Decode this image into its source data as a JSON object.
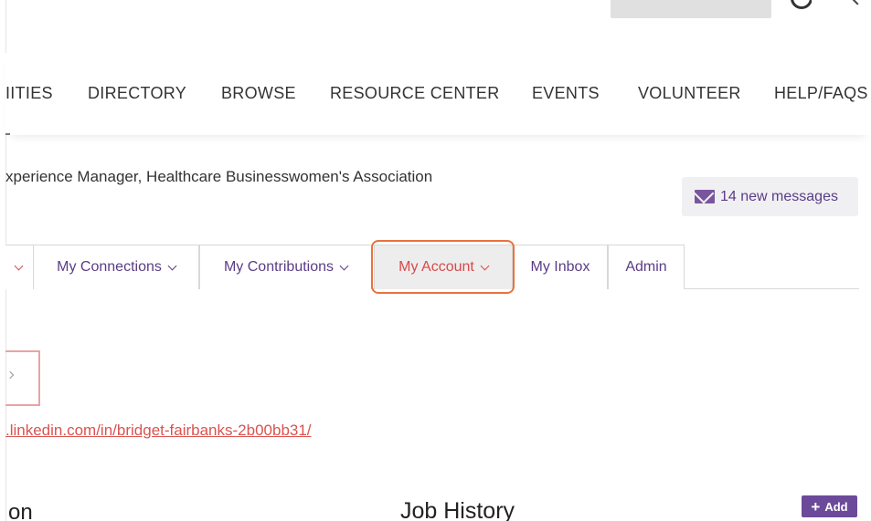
{
  "nav": {
    "items": [
      {
        "label": "IITIES"
      },
      {
        "label": "DIRECTORY"
      },
      {
        "label": "BROWSE"
      },
      {
        "label": "RESOURCE CENTER"
      },
      {
        "label": "EVENTS"
      },
      {
        "label": "VOLUNTEER"
      },
      {
        "label": "HELP/FAQS"
      }
    ]
  },
  "profile": {
    "subtitle": "xperience Manager, Healthcare Businesswomen's Association",
    "messages_label": "14 new messages",
    "linkedin_url": ".linkedin.com/in/bridget-fairbanks-2b00bb31/"
  },
  "tabs": [
    {
      "label": "My Connections"
    },
    {
      "label": "My Contributions"
    },
    {
      "label": "My Account"
    },
    {
      "label": "My Inbox"
    },
    {
      "label": "Admin"
    }
  ],
  "sections": {
    "left_heading": "on",
    "job_history": "Job History",
    "add_label": "Add"
  },
  "icons": {
    "envelope": "envelope-icon",
    "plus": "plus-icon",
    "chevron": "chevron-down-icon"
  },
  "colors": {
    "brand_purple": "#6c4a9a",
    "link_red": "#d9534f",
    "highlight_orange": "#e8733e"
  }
}
